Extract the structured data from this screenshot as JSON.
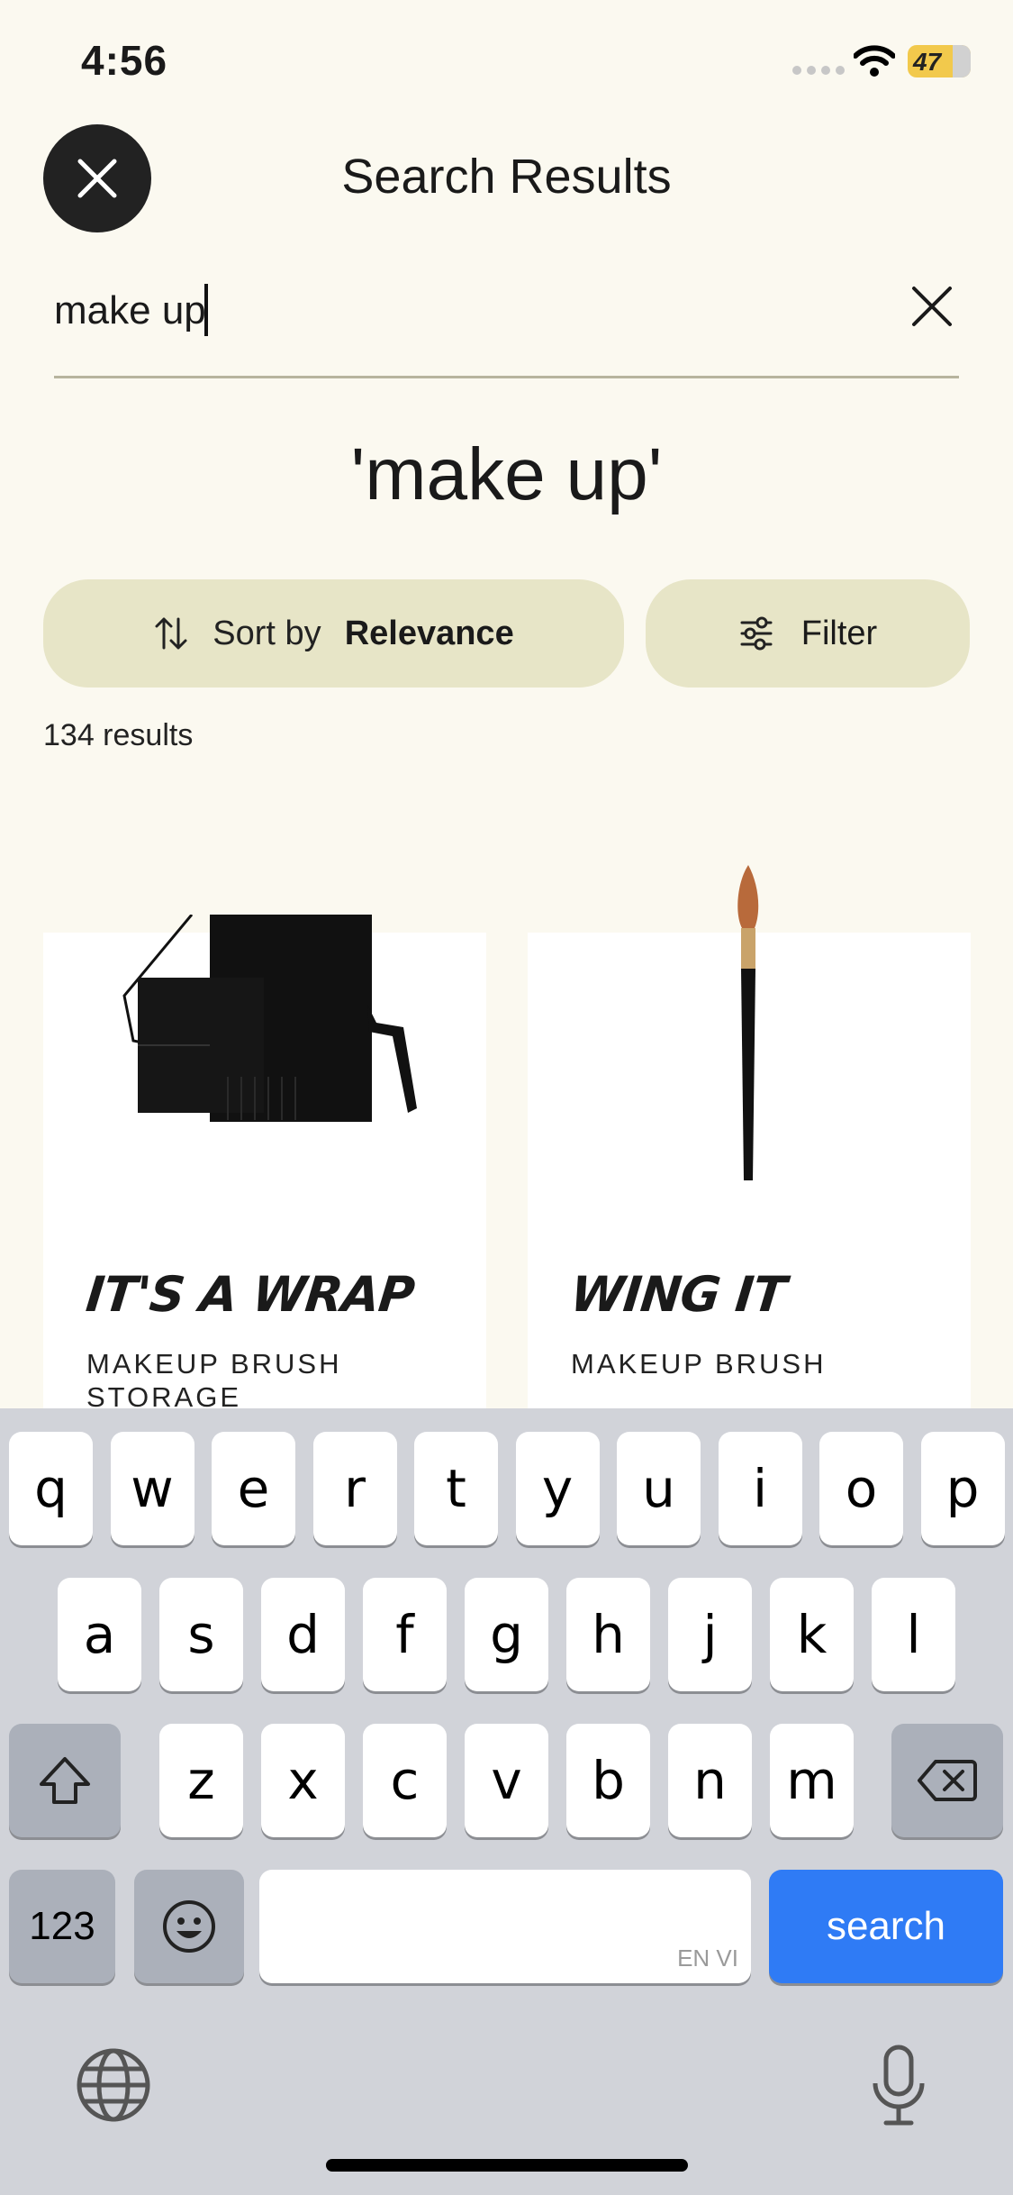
{
  "status_bar": {
    "time": "4:56",
    "battery": "47"
  },
  "header": {
    "title": "Search Results",
    "close_icon": "close-icon"
  },
  "search": {
    "value": "make up",
    "clear_icon": "close-icon"
  },
  "query_heading": "'make up'",
  "sort": {
    "label": "Sort by",
    "value": "Relevance",
    "icon": "sort-arrows-icon"
  },
  "filter": {
    "label": "Filter",
    "icon": "sliders-icon"
  },
  "results_count": "134 results",
  "products": [
    {
      "name": "IT'S A WRAP",
      "type": "MAKEUP BRUSH STORAGE",
      "image": "brush-roll-image"
    },
    {
      "name": "WING IT",
      "type": "MAKEUP BRUSH",
      "image": "makeup-brush-image"
    }
  ],
  "keyboard": {
    "row1": [
      "q",
      "w",
      "e",
      "r",
      "t",
      "y",
      "u",
      "i",
      "o",
      "p"
    ],
    "row2": [
      "a",
      "s",
      "d",
      "f",
      "g",
      "h",
      "j",
      "k",
      "l"
    ],
    "row3": [
      "z",
      "x",
      "c",
      "v",
      "b",
      "n",
      "m"
    ],
    "numbers_label": "123",
    "space_hint": "EN VI",
    "return_label": "search"
  },
  "colors": {
    "background": "#fbf9f0",
    "pill": "#e7e5c7",
    "search_key": "#2f7bf5"
  }
}
